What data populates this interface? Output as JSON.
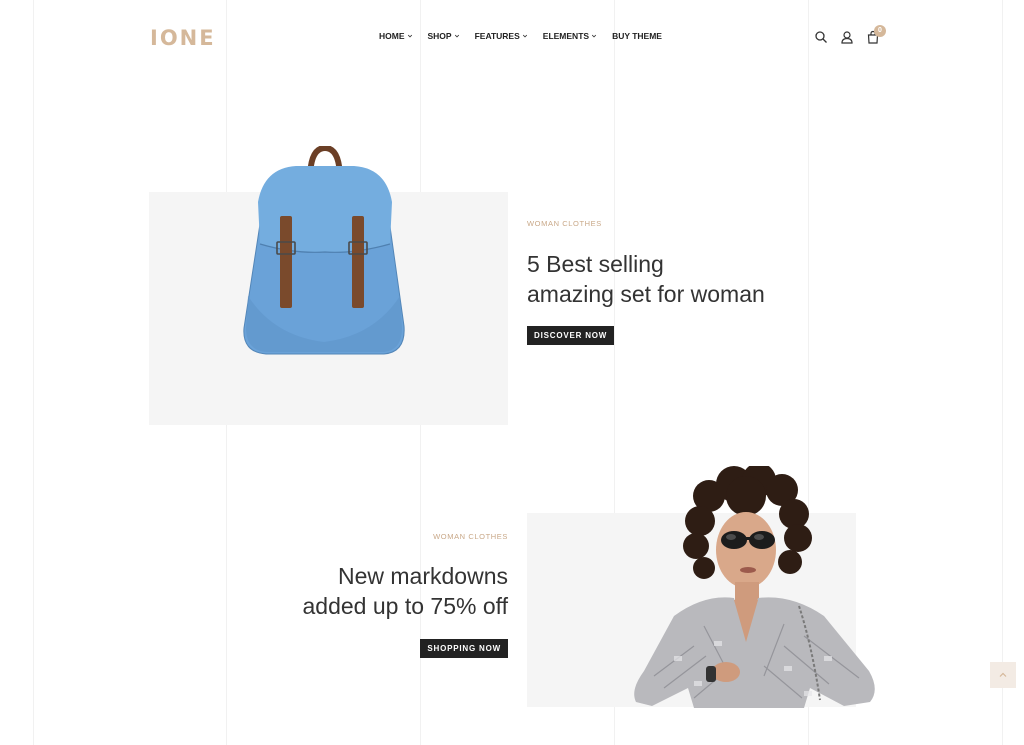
{
  "header": {
    "logo": "IONE",
    "nav": [
      {
        "label": "HOME",
        "has_dropdown": true
      },
      {
        "label": "SHOP",
        "has_dropdown": true
      },
      {
        "label": "FEATURES",
        "has_dropdown": true
      },
      {
        "label": "ELEMENTS",
        "has_dropdown": true
      },
      {
        "label": "BUY THEME",
        "has_dropdown": false
      }
    ],
    "cart_count": "0",
    "icons": [
      "search-icon",
      "user-icon",
      "cart-icon"
    ]
  },
  "banner1": {
    "category": "WOMAN CLOTHES",
    "title_line1": "5 Best selling",
    "title_line2": "amazing set for woman",
    "button": "DISCOVER NOW",
    "image": "blue-backpack"
  },
  "banner2": {
    "category": "WOMAN CLOTHES",
    "title_line1": "New markdowns",
    "title_line2": "added up to 75% off",
    "button": "SHOPPING NOW",
    "image": "woman-silver-jacket"
  },
  "colors": {
    "accent": "#d5b89a",
    "button_bg": "#222222",
    "panel_bg": "#f5f5f5"
  }
}
